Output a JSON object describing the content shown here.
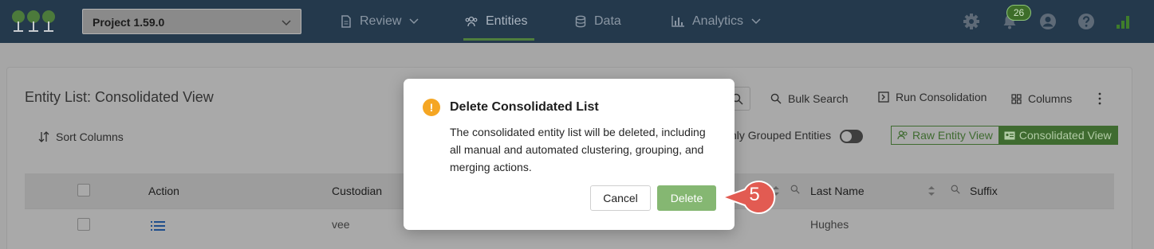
{
  "topbar": {
    "project": "Project 1.59.0",
    "nav": [
      {
        "label": "Review"
      },
      {
        "label": "Entities"
      },
      {
        "label": "Data"
      },
      {
        "label": "Analytics"
      }
    ],
    "notification_count": "26"
  },
  "panel": {
    "title": "Entity List: Consolidated View",
    "toolbar": {
      "bulk_search": "Bulk Search",
      "run_consolidation": "Run Consolidation",
      "columns": "Columns",
      "sort_columns": "Sort Columns",
      "grouped_label": "nly Grouped Entities",
      "raw_view": "Raw Entity View",
      "consolidated_view": "Consolidated View"
    },
    "table": {
      "headers": [
        "Action",
        "Custodian",
        "Last Name",
        "Suffix"
      ],
      "rows": [
        {
          "custodian": "vee",
          "last_name": "Hughes"
        }
      ]
    }
  },
  "modal": {
    "title": "Delete Consolidated List",
    "body": "The consolidated entity list will be deleted, including all manual and automated clustering, grouping, and merging actions.",
    "cancel": "Cancel",
    "delete": "Delete"
  },
  "callout": {
    "step": "5"
  },
  "colors": {
    "topbar": "#24394c",
    "accent_green": "#3f6b30",
    "delete_button": "#85b772",
    "warning": "#f5a623",
    "callout": "#e25b52"
  },
  "icons": [
    "logo-trees-icon",
    "chevron-down-icon",
    "document-icon",
    "users-icon",
    "database-icon",
    "bar-chart-icon",
    "gear-icon",
    "bell-icon",
    "user-circle-icon",
    "help-icon",
    "signal-icon",
    "search-icon",
    "run-icon",
    "columns-grid-icon",
    "more-vertical-icon",
    "sort-icon",
    "list-icon",
    "warning-icon"
  ]
}
